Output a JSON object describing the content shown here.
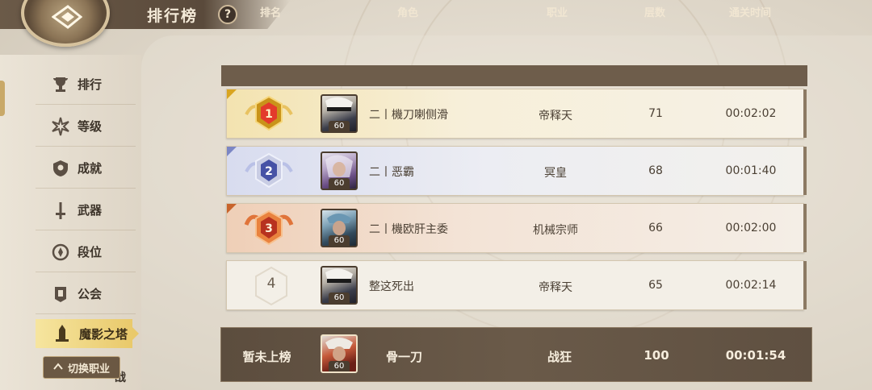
{
  "header": {
    "title": "排行榜",
    "help": "?"
  },
  "sidebar": {
    "items": [
      {
        "label": "排行",
        "icon": "trophy-icon"
      },
      {
        "label": "等级",
        "icon": "star-burst-icon"
      },
      {
        "label": "成就",
        "icon": "shield-badge-icon"
      },
      {
        "label": "武器",
        "icon": "sword-icon"
      },
      {
        "label": "段位",
        "icon": "rank-emblem-icon"
      },
      {
        "label": "公会",
        "icon": "guild-banner-icon"
      },
      {
        "label": "魔影之塔",
        "icon": "tower-icon",
        "active": true
      }
    ],
    "switch_button": "切换职业",
    "partial_hidden_label": "战"
  },
  "table": {
    "columns": [
      "排名",
      "角色",
      "职业",
      "层数",
      "通关时间"
    ],
    "rows": [
      {
        "rank": "1",
        "name": "二丨機刀喇侧滑",
        "class": "帝释天",
        "floors": "71",
        "time": "00:02:02",
        "level": "60"
      },
      {
        "rank": "2",
        "name": "二丨恶霸",
        "class": "冥皇",
        "floors": "68",
        "time": "00:01:40",
        "level": "60"
      },
      {
        "rank": "3",
        "name": "二丨機欧肝主委",
        "class": "机械宗师",
        "floors": "66",
        "time": "00:02:00",
        "level": "60"
      },
      {
        "rank": "4",
        "name": "整这死出",
        "class": "帝释天",
        "floors": "65",
        "time": "00:02:14",
        "level": "60"
      }
    ],
    "self": {
      "rank": "暂未上榜",
      "name": "骨一刀",
      "class": "战狂",
      "floors": "100",
      "time": "00:01:54",
      "level": "60"
    }
  },
  "colors": {
    "gold": "#d9a521",
    "silver": "#7b86c4",
    "bronze": "#c8642c",
    "header_bar": "#6e5d4b"
  }
}
